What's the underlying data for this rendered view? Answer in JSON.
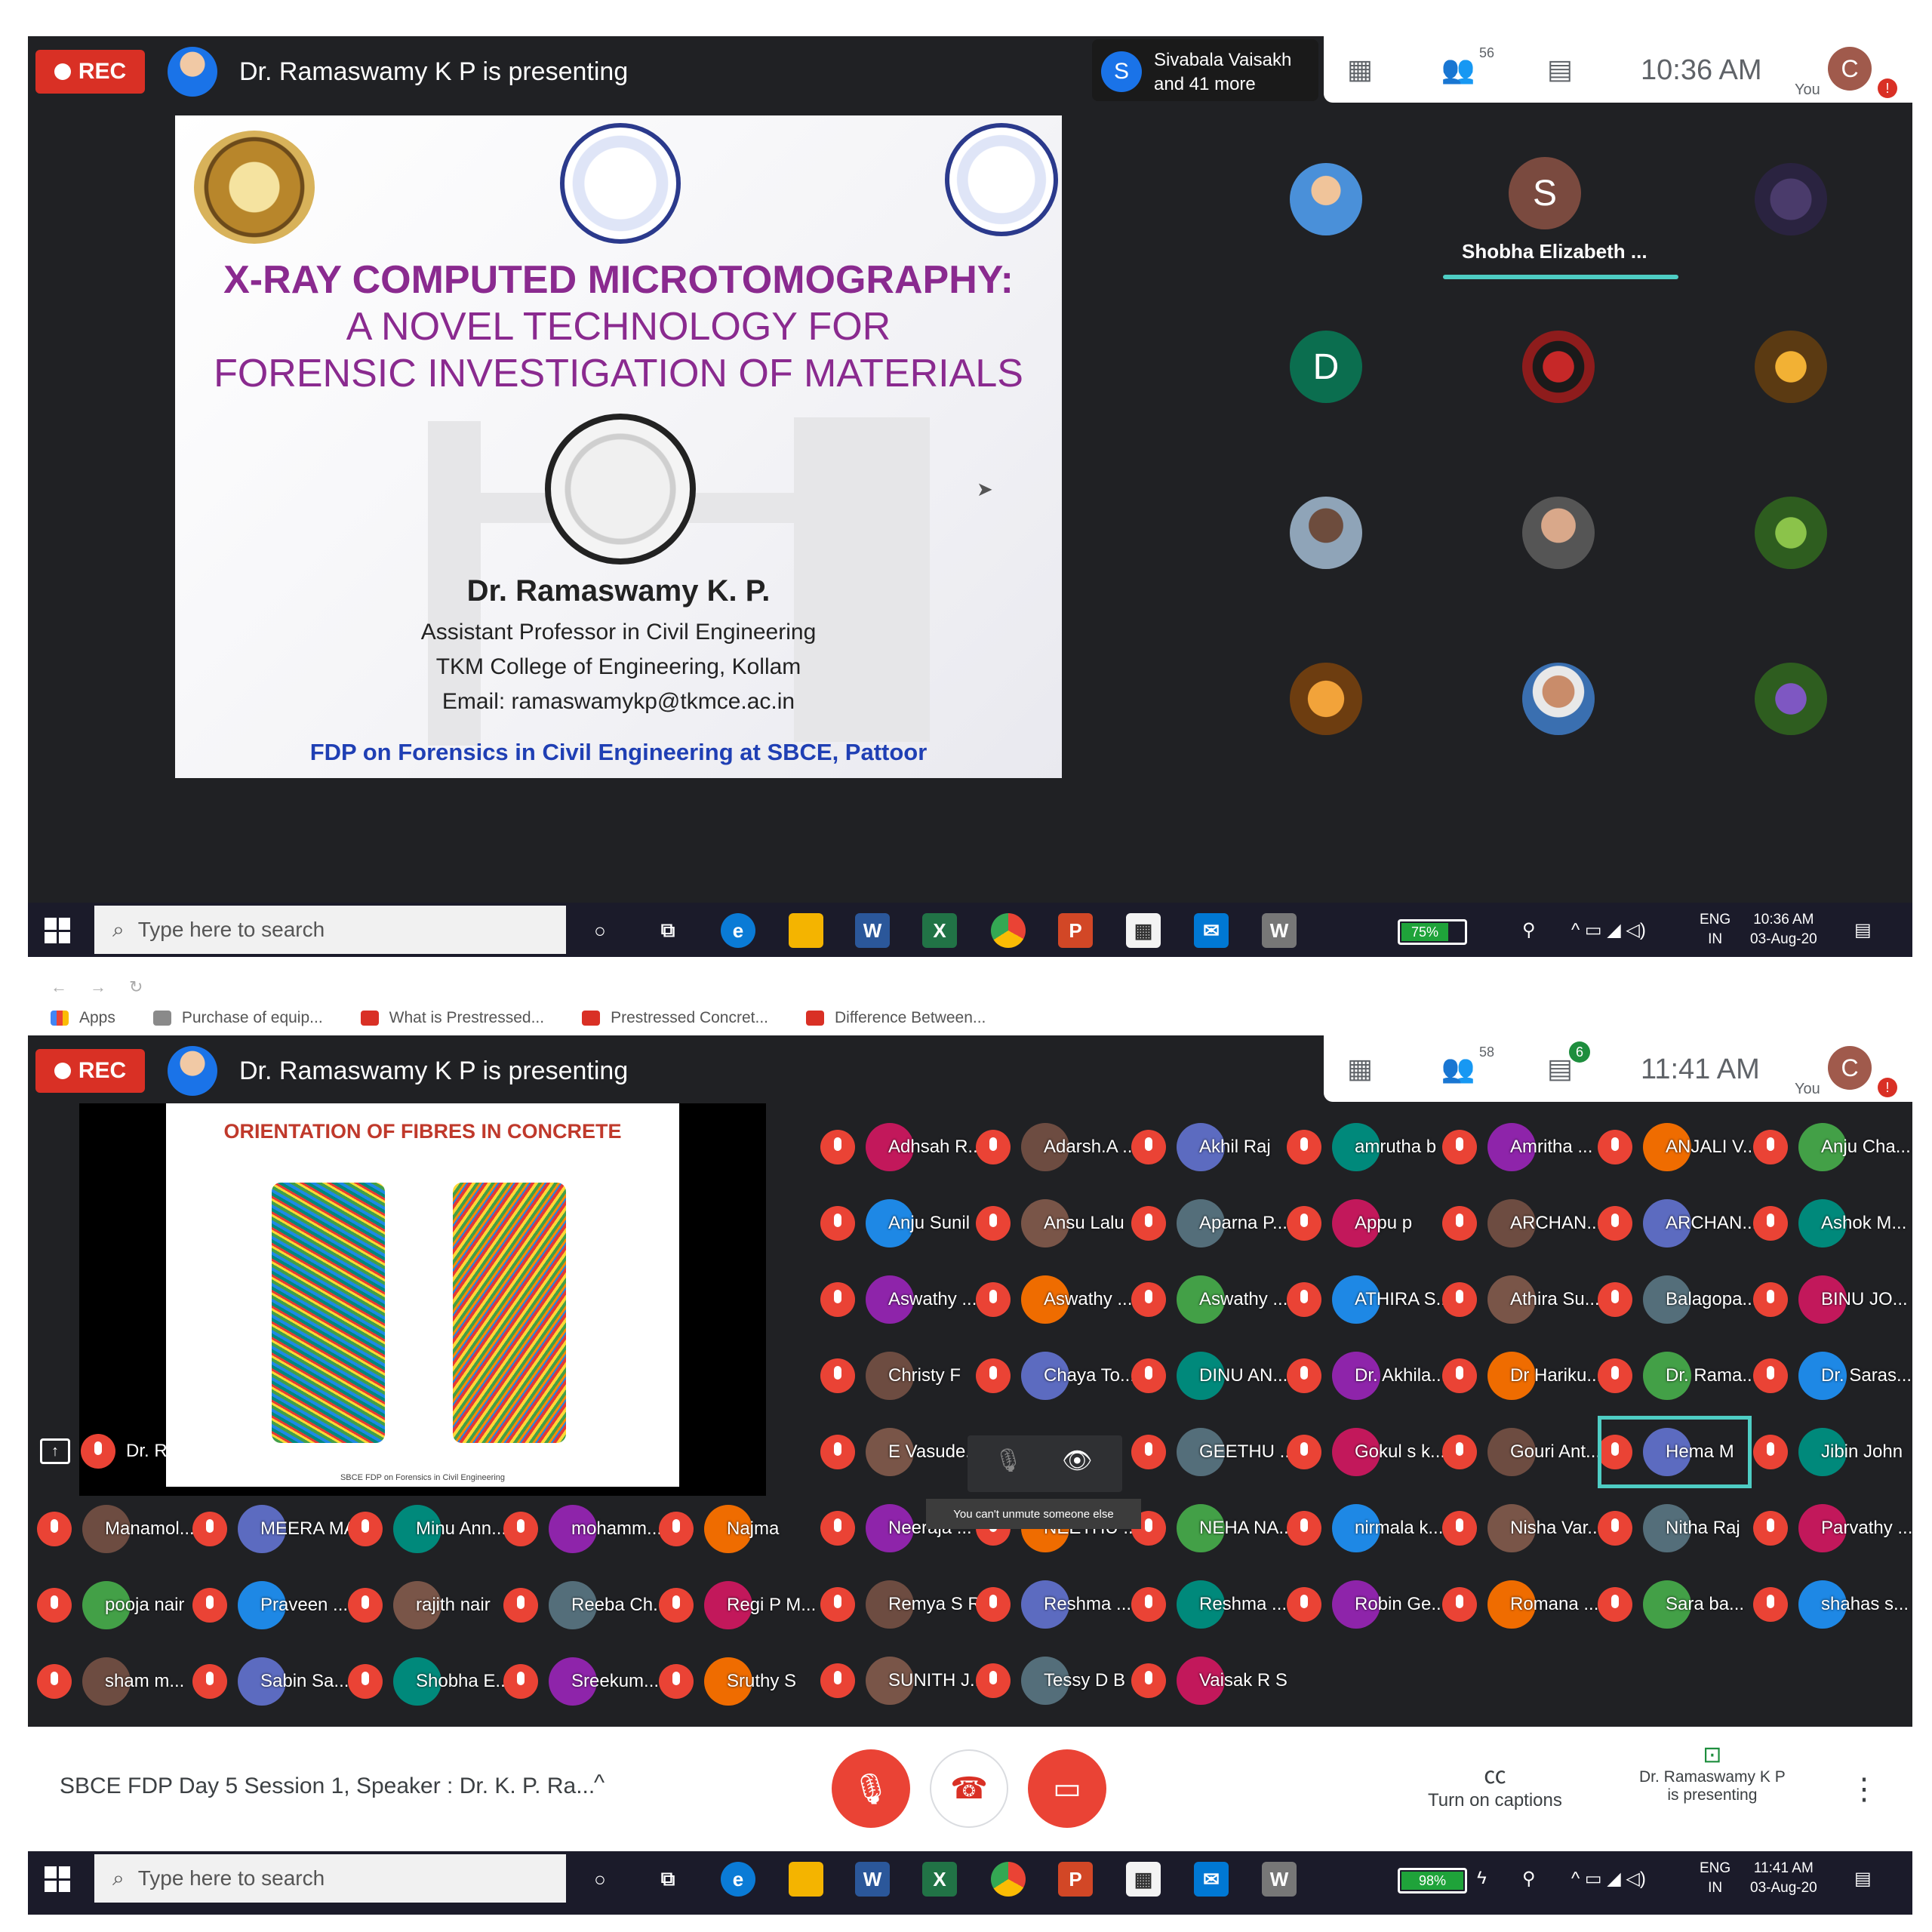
{
  "top": {
    "rec_label": "REC",
    "presenting_text": "Dr. Ramaswamy K P is presenting",
    "active_speaker": "Sivabala Vaisakh and 41 more",
    "active_speaker_initial": "S",
    "participants_badge": "56",
    "clock": "10:36 AM",
    "you_initial": "C",
    "you_label": "You",
    "slide": {
      "title1": "X-RAY COMPUTED MICROTOMOGRAPHY:",
      "title2": "A NOVEL TECHNOLOGY FOR",
      "title3": "FORENSIC INVESTIGATION OF MATERIALS",
      "speaker": "Dr. Ramaswamy K. P.",
      "role": "Assistant Professor in Civil Engineering",
      "college": "TKM College of Engineering, Kollam",
      "email": "Email: ramaswamykp@tkmce.ac.in",
      "footer": "FDP on Forensics in Civil Engineering at SBCE, Pattoor"
    },
    "grid": {
      "speaking_initial": "S",
      "speaking_name": "Shobha Elizabeth ...",
      "d_initial": "D"
    },
    "taskbar": {
      "search_placeholder": "Type here to search",
      "battery": "75%",
      "lang": "ENG",
      "region": "IN",
      "time": "10:36 AM",
      "date": "03-Aug-20"
    }
  },
  "bottom": {
    "bookmarks": [
      "Apps",
      "Purchase of equip...",
      "What is Prestressed...",
      "Prestressed Concret...",
      "Difference Between..."
    ],
    "rec_label": "REC",
    "presenting_text": "Dr. Ramaswamy K P is presenting",
    "participants_badge": "58",
    "chat_badge": "6",
    "clock": "11:41 AM",
    "you_initial": "C",
    "you_label": "You",
    "slide_title": "ORIENTATION OF FIBRES IN CONCRETE",
    "slide_footer": "SBCE FDP on Forensics in Civil Engineering",
    "pinned_label": "Dr. Ramaswamy K P",
    "tooltip": "You can't unmute someone else",
    "participants": [
      [
        "Adhsah R...",
        "Adarsh.A ...",
        "Akhil Raj",
        "amrutha b",
        "Amritha ...",
        "ANJALI V...",
        "Anju Cha..."
      ],
      [
        "Anju Sunil",
        "Ansu Lalu",
        "Aparna P...",
        "Appu p",
        "ARCHAN...",
        "ARCHAN...",
        "Ashok M..."
      ],
      [
        "Aswathy ...",
        "Aswathy ...",
        "Aswathy ...",
        "ATHIRA S...",
        "Athira Su...",
        "Balagopa...",
        "BINU JO..."
      ],
      [
        "Christy F",
        "Chaya To...",
        "DINU AN...",
        "Dr. Akhila...",
        "Dr Hariku...",
        "Dr. Rama...",
        "Dr. Saras..."
      ],
      [
        "E Vasude...",
        "",
        "GEETHU ...",
        "Gokul s k...",
        "Gouri Ant...",
        "Hema M",
        "Jibin John"
      ],
      [
        "Neeraja ...",
        "NEETHU ...",
        "NEHA NA...",
        "nirmala k...",
        "Nisha Var...",
        "Nitha Raj",
        "Parvathy ..."
      ],
      [
        "Remya S R",
        "Reshma ...",
        "Reshma ...",
        "Robin Ge...",
        "Romana ...",
        "Sara ba...",
        "shahas s..."
      ],
      [
        "SUNITH J...",
        "Tessy D B",
        "Vaisak R S"
      ]
    ],
    "left_participants": [
      [
        "Manamol...",
        "MEERA MA...",
        "Minu Ann...",
        "mohamm...",
        "Najma"
      ],
      [
        "pooja nair",
        "Praveen ...",
        "rajith nair",
        "Reeba Ch...",
        "Regi P M..."
      ],
      [
        "sham m...",
        "Sabin Sa...",
        "Shobha E...",
        "Sreekum...",
        "Sruthy S"
      ]
    ],
    "meeting_title": "SBCE FDP Day 5 Session 1, Speaker : Dr. K. P. Ra...",
    "captions_label": "Turn on captions",
    "presenting_label_1": "Dr. Ramaswamy K P",
    "presenting_label_2": "is presenting",
    "taskbar": {
      "search_placeholder": "Type here to search",
      "battery": "98%",
      "lang": "ENG",
      "region": "IN",
      "time": "11:41 AM",
      "date": "03-Aug-20"
    }
  }
}
